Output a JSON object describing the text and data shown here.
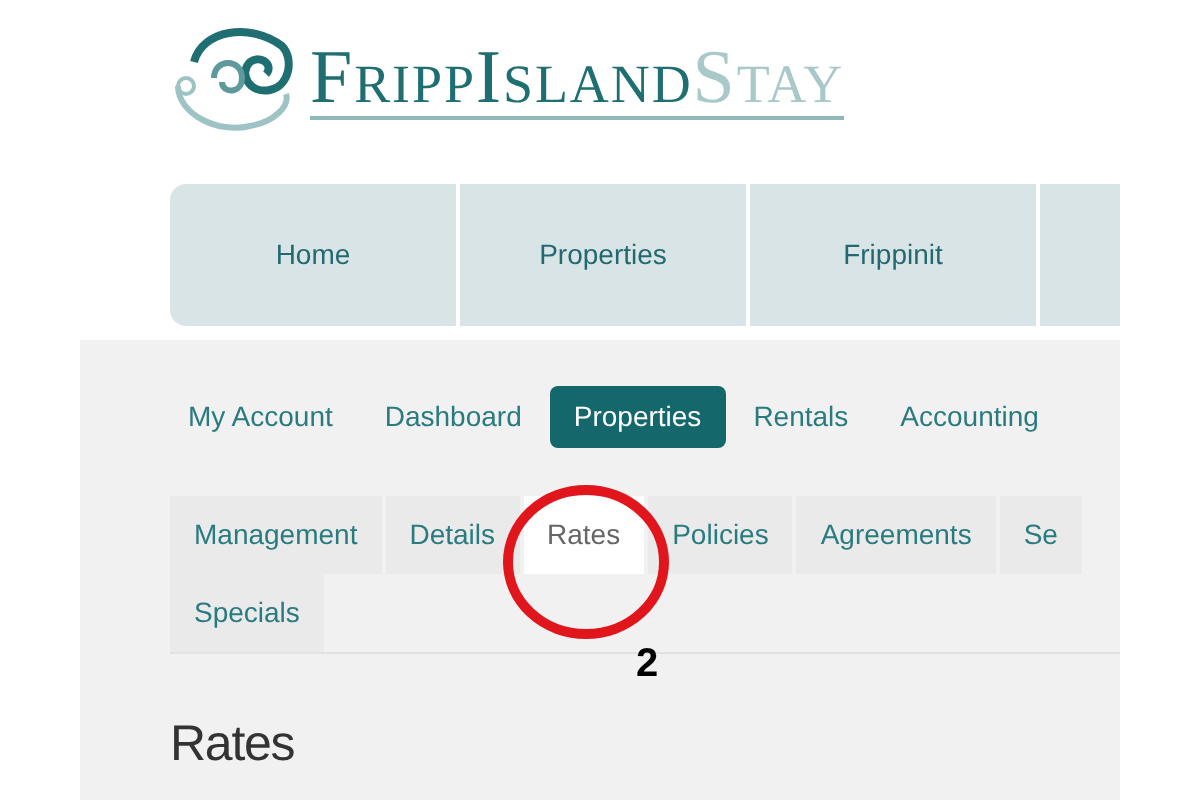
{
  "logo": {
    "name_primary": "FrippIsland",
    "name_secondary": "Stay"
  },
  "nav": [
    {
      "label": "Home"
    },
    {
      "label": "Properties"
    },
    {
      "label": "Frippinit"
    }
  ],
  "main_tabs": [
    {
      "label": "My Account",
      "selected": false
    },
    {
      "label": "Dashboard",
      "selected": false
    },
    {
      "label": "Properties",
      "selected": true
    },
    {
      "label": "Rentals",
      "selected": false
    },
    {
      "label": "Accounting",
      "selected": false
    }
  ],
  "sub_tabs": [
    {
      "label": "Management",
      "selected": false
    },
    {
      "label": "Details",
      "selected": false
    },
    {
      "label": "Rates",
      "selected": true
    },
    {
      "label": "Policies",
      "selected": false
    },
    {
      "label": "Agreements",
      "selected": false
    },
    {
      "label": "Se",
      "selected": false
    },
    {
      "label": "Specials",
      "selected": false
    }
  ],
  "heading": "Rates",
  "annotation": {
    "number": "2"
  }
}
